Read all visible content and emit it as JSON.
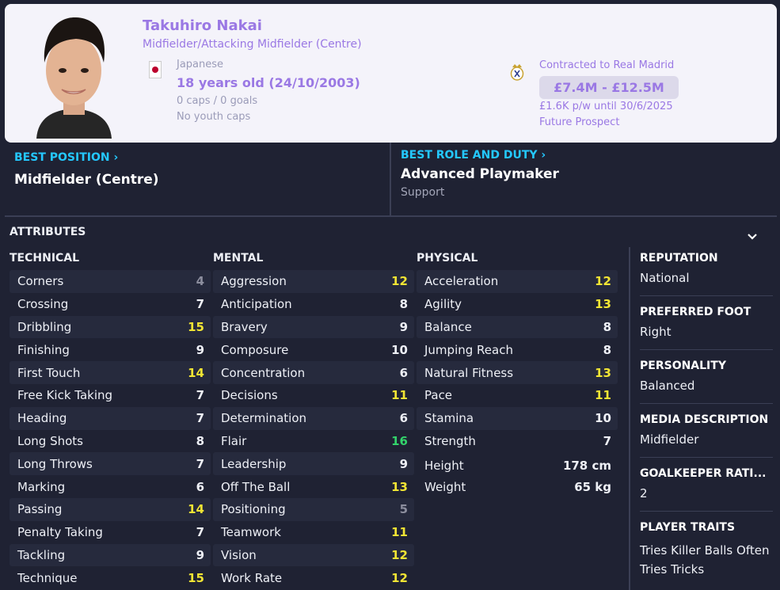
{
  "player": {
    "name": "Takuhiro Nakai",
    "positions": "Midfielder/Attacking Midfielder (Centre)",
    "nationality": "Japanese",
    "age": "18 years old",
    "dob": "(24/10/2003)",
    "caps": "0 caps / 0 goals",
    "youth_caps": "No youth caps"
  },
  "contract": {
    "club_line": "Contracted to Real Madrid",
    "value": "£7.4M - £12.5M",
    "wage": "£1.6K p/w until 30/6/2025",
    "status": "Future Prospect"
  },
  "best_position": {
    "label": "BEST POSITION",
    "value": "Midfielder (Centre)"
  },
  "best_role": {
    "label": "BEST ROLE AND DUTY",
    "value": "Advanced Playmaker",
    "duty": "Support"
  },
  "attributes": {
    "title": "ATTRIBUTES",
    "technical": {
      "label": "TECHNICAL",
      "items": [
        {
          "name": "Corners",
          "value": "4"
        },
        {
          "name": "Crossing",
          "value": "7"
        },
        {
          "name": "Dribbling",
          "value": "15"
        },
        {
          "name": "Finishing",
          "value": "9"
        },
        {
          "name": "First Touch",
          "value": "14"
        },
        {
          "name": "Free Kick Taking",
          "value": "7"
        },
        {
          "name": "Heading",
          "value": "7"
        },
        {
          "name": "Long Shots",
          "value": "8"
        },
        {
          "name": "Long Throws",
          "value": "7"
        },
        {
          "name": "Marking",
          "value": "6"
        },
        {
          "name": "Passing",
          "value": "14"
        },
        {
          "name": "Penalty Taking",
          "value": "7"
        },
        {
          "name": "Tackling",
          "value": "9"
        },
        {
          "name": "Technique",
          "value": "15"
        }
      ]
    },
    "mental": {
      "label": "MENTAL",
      "items": [
        {
          "name": "Aggression",
          "value": "12"
        },
        {
          "name": "Anticipation",
          "value": "8"
        },
        {
          "name": "Bravery",
          "value": "9"
        },
        {
          "name": "Composure",
          "value": "10"
        },
        {
          "name": "Concentration",
          "value": "6"
        },
        {
          "name": "Decisions",
          "value": "11"
        },
        {
          "name": "Determination",
          "value": "6"
        },
        {
          "name": "Flair",
          "value": "16"
        },
        {
          "name": "Leadership",
          "value": "9"
        },
        {
          "name": "Off The Ball",
          "value": "13"
        },
        {
          "name": "Positioning",
          "value": "5"
        },
        {
          "name": "Teamwork",
          "value": "11"
        },
        {
          "name": "Vision",
          "value": "12"
        },
        {
          "name": "Work Rate",
          "value": "12"
        }
      ]
    },
    "physical": {
      "label": "PHYSICAL",
      "items": [
        {
          "name": "Acceleration",
          "value": "12"
        },
        {
          "name": "Agility",
          "value": "13"
        },
        {
          "name": "Balance",
          "value": "8"
        },
        {
          "name": "Jumping Reach",
          "value": "8"
        },
        {
          "name": "Natural Fitness",
          "value": "13"
        },
        {
          "name": "Pace",
          "value": "11"
        },
        {
          "name": "Stamina",
          "value": "10"
        },
        {
          "name": "Strength",
          "value": "7"
        }
      ],
      "height_label": "Height",
      "height": "178 cm",
      "weight_label": "Weight",
      "weight": "65 kg"
    }
  },
  "sidebar": {
    "reputation_label": "REPUTATION",
    "reputation": "National",
    "foot_label": "PREFERRED FOOT",
    "foot": "Right",
    "personality_label": "PERSONALITY",
    "personality": "Balanced",
    "media_label": "MEDIA DESCRIPTION",
    "media": "Midfielder",
    "gk_label": "GOALKEEPER RATI...",
    "gk": "2",
    "traits_label": "PLAYER TRAITS",
    "traits": [
      "Tries Killer Balls Often",
      "Tries Tricks"
    ]
  },
  "colors": {
    "accent_purple": "#9a78e4",
    "heading_cyan": "#24c8ff",
    "value_great": "#33d36b",
    "value_good": "#f2e534",
    "value_low": "#8c8e9e"
  }
}
